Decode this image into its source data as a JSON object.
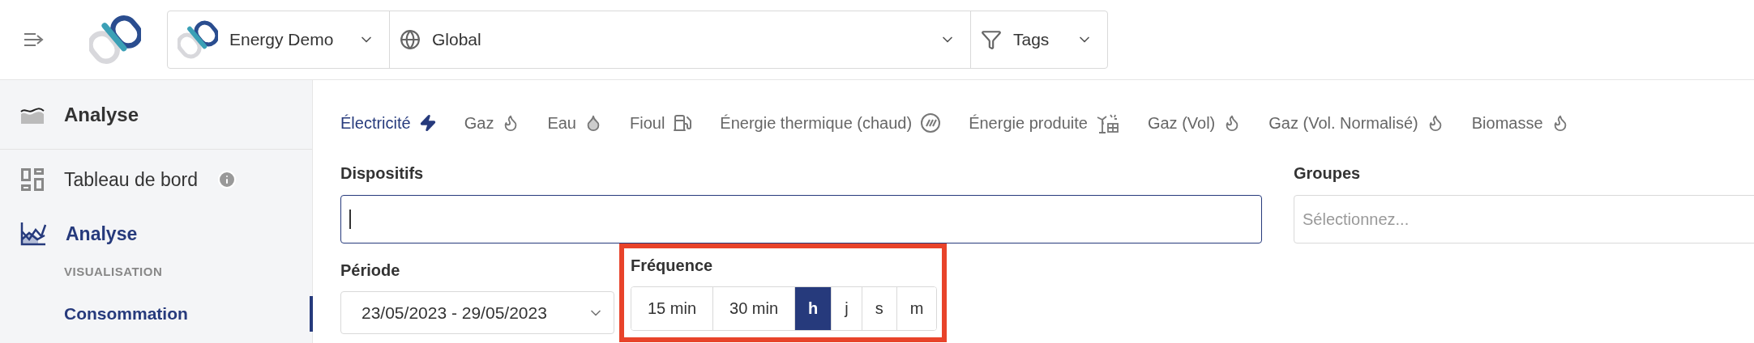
{
  "top_bar": {
    "site": "Energy Demo",
    "scope": "Global",
    "filter": "Tags"
  },
  "sidebar": {
    "header": "Analyse",
    "items": [
      {
        "label": "Tableau de bord",
        "kind": "dashboard",
        "info": true,
        "selected": false
      },
      {
        "label": "Analyse",
        "kind": "analysis",
        "info": false,
        "selected": true
      }
    ],
    "section_title": "VISUALISATION",
    "sub_items": [
      {
        "label": "Consommation",
        "selected": true
      }
    ]
  },
  "energy_tabs": [
    {
      "label": "Électricité",
      "kind": "electricity",
      "selected": true
    },
    {
      "label": "Gaz",
      "kind": "gas",
      "selected": false
    },
    {
      "label": "Eau",
      "kind": "water",
      "selected": false
    },
    {
      "label": "Fioul",
      "kind": "fuel",
      "selected": false
    },
    {
      "label": "Énergie thermique (chaud)",
      "kind": "thermal",
      "selected": false
    },
    {
      "label": "Énergie produite",
      "kind": "produced",
      "selected": false
    },
    {
      "label": "Gaz (Vol)",
      "kind": "gas",
      "selected": false
    },
    {
      "label": "Gaz (Vol. Normalisé)",
      "kind": "gas",
      "selected": false
    },
    {
      "label": "Biomasse",
      "kind": "gas",
      "selected": false
    }
  ],
  "devices": {
    "label": "Dispositifs",
    "focused": true
  },
  "groups": {
    "label": "Groupes",
    "placeholder": "Sélectionnez..."
  },
  "period": {
    "label": "Période",
    "value": "23/05/2023 - 29/05/2023"
  },
  "frequency": {
    "label": "Fréquence",
    "highlighted": true,
    "options": [
      {
        "label": "15 min",
        "selected": false
      },
      {
        "label": "30 min",
        "selected": false
      },
      {
        "label": "h",
        "selected": true
      },
      {
        "label": "j",
        "selected": false
      },
      {
        "label": "s",
        "selected": false
      },
      {
        "label": "m",
        "selected": false
      }
    ]
  }
}
